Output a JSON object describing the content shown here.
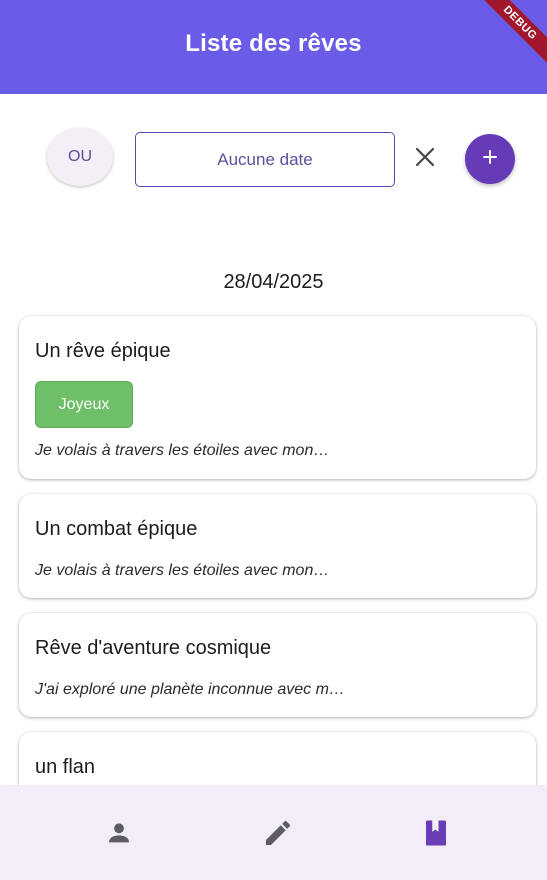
{
  "app_bar": {
    "title": "Liste des rêves",
    "debug_label": "DEBUG"
  },
  "filters": {
    "operator_label": "OU",
    "date_placeholder": "Aucune date"
  },
  "date_header": "28/04/2025",
  "dreams": [
    {
      "title": "Un rêve épique",
      "tag": "Joyeux",
      "excerpt": "Je volais à travers les étoiles avec mon…"
    },
    {
      "title": "Un combat épique",
      "excerpt": "Je volais à travers les étoiles avec mon…"
    },
    {
      "title": "Rêve d'aventure cosmique",
      "excerpt": "J'ai exploré une planète inconnue avec m…"
    },
    {
      "title": "un flan"
    }
  ],
  "colors": {
    "primary": "#6b5ce7",
    "accent": "#673ab7",
    "tag_joyeux": "#6fbf69",
    "nav_background": "#f3edf7",
    "nav_active": "#6a3fb5",
    "nav_inactive": "#5f5b66"
  },
  "bottom_nav": {
    "items": [
      {
        "icon": "person-icon",
        "active": false
      },
      {
        "icon": "edit-pencil-icon",
        "active": false
      },
      {
        "icon": "book-icon",
        "active": true
      }
    ]
  }
}
